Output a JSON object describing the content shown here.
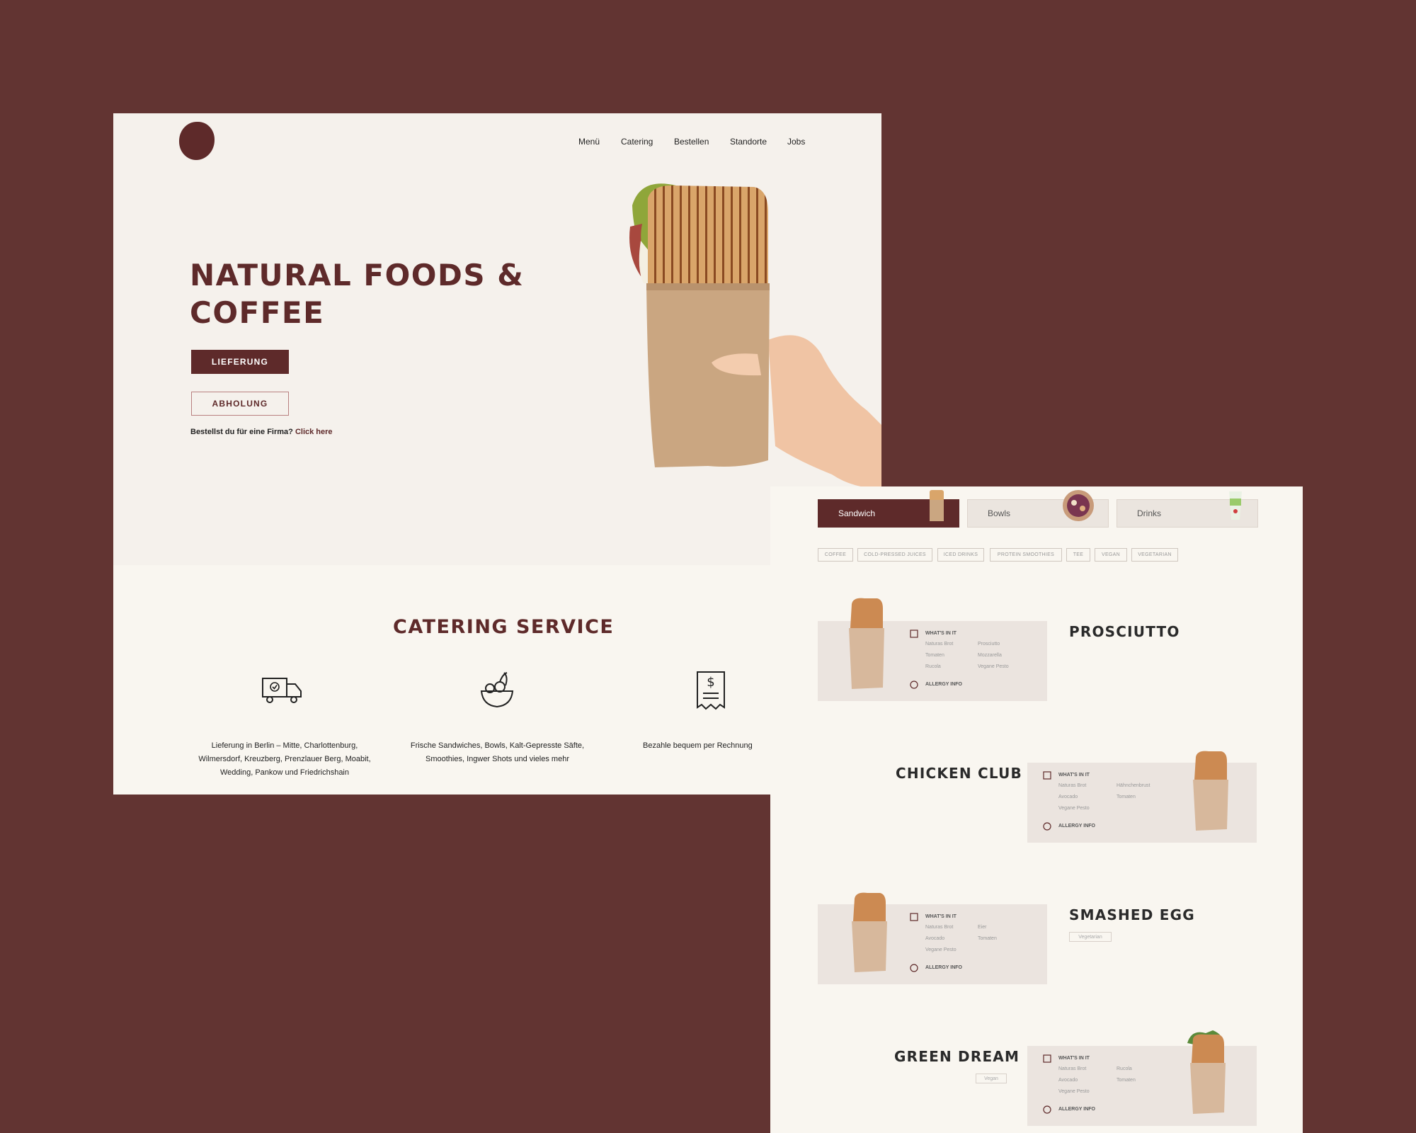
{
  "nav": {
    "items": [
      "Menü",
      "Catering",
      "Bestellen",
      "Standorte",
      "Jobs"
    ]
  },
  "hero": {
    "title": "NATURAL FOODS & COFFEE",
    "btn_delivery": "LIEFERUNG",
    "btn_pickup": "ABHOLUNG",
    "company_text": "Bestellst du für eine Firma?",
    "company_link": "Click here"
  },
  "catering": {
    "title": "CATERING SERVICE",
    "items": [
      {
        "icon": "delivery-truck-icon",
        "text": "Lieferung in Berlin – Mitte, Charlottenburg, Wilmersdorf, Kreuzberg, Prenzlauer Berg, Moabit, Wedding, Pankow und Friedrichshain"
      },
      {
        "icon": "salad-bowl-icon",
        "text": "Frische Sandwiches, Bowls, Kalt-Gepresste Säfte, Smoothies, Ingwer Shots und vieles mehr"
      },
      {
        "icon": "receipt-icon",
        "text": "Bezahle bequem per Rechnung"
      }
    ]
  },
  "menu": {
    "tabs": [
      "Sandwich",
      "Bowls",
      "Drinks"
    ],
    "active_tab": "Sandwich",
    "filters": [
      "COFFEE",
      "COLD-PRESSED JUICES",
      "ICED DRINKS",
      "PROTEIN SMOOTHIES",
      "TEE",
      "VEGAN",
      "VEGETARIAN"
    ],
    "whats_in_label": "WHAT'S IN IT",
    "allergy_label": "ALLERGY INFO",
    "products": [
      {
        "name": "PROSCIUTTO",
        "tag": "",
        "col1": [
          "Naturas Brot",
          "Tomaten",
          "Rucola"
        ],
        "col2": [
          "Prosciutto",
          "Mozzarella",
          "Vegane Pesto"
        ]
      },
      {
        "name": "CHICKEN CLUB",
        "tag": "",
        "col1": [
          "Naturas Brot",
          "Avocado",
          "Vegane Pesto"
        ],
        "col2": [
          "Hähnchenbrust",
          "Tomaten"
        ]
      },
      {
        "name": "SMASHED EGG",
        "tag": "Vegetarian",
        "col1": [
          "Naturas Brot",
          "Avocado",
          "Vegane Pesto"
        ],
        "col2": [
          "Eier",
          "Tomaten"
        ]
      },
      {
        "name": "GREEN DREAM",
        "tag": "Vegan",
        "col1": [
          "Naturas Brot",
          "Avocado",
          "Vegane Pesto"
        ],
        "col2": [
          "Rucola",
          "Tomaten"
        ]
      }
    ]
  },
  "colors": {
    "background": "#623432",
    "brand": "#5e2a2a",
    "page": "#f9f6f0",
    "card": "#ebe4df"
  }
}
